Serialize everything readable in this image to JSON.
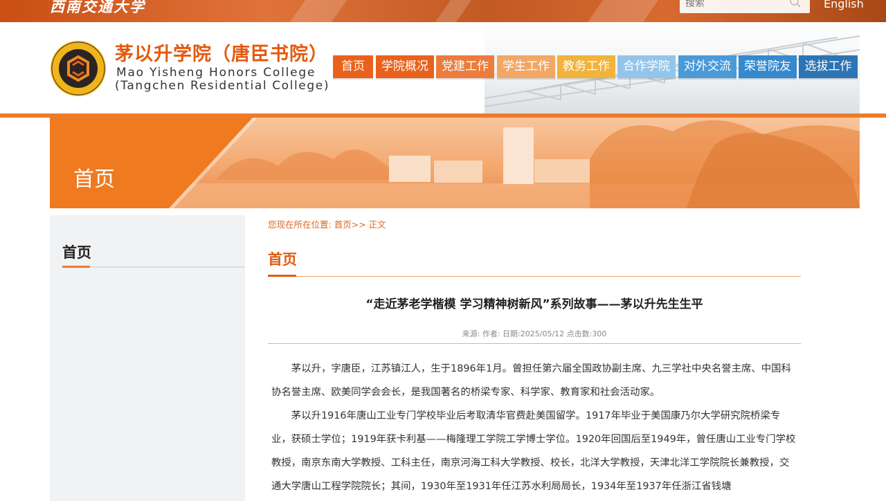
{
  "topbar": {
    "university_name": "西南交通大学",
    "search_placeholder": "搜索",
    "english_link": "English"
  },
  "header": {
    "college_name_cn": "茅以升学院（唐臣书院）",
    "college_name_en_line1": "Mao Yisheng Honors College",
    "college_name_en_line2": "(Tangchen Residential College)",
    "logo_ring_text": "MAO YISHENG HONORS COLLEGE",
    "logo_bottom_text": "西南交通大学茅以升学院"
  },
  "nav": {
    "items": [
      {
        "label": "首页",
        "color": "#e8621d"
      },
      {
        "label": "学院概况",
        "color": "#e8621d"
      },
      {
        "label": "党建工作",
        "color": "#ec7c3c"
      },
      {
        "label": "学生工作",
        "color": "#f2a765"
      },
      {
        "label": "教务工作",
        "color": "#f1b33c"
      },
      {
        "label": "合作学院",
        "color": "#93c5ea"
      },
      {
        "label": "对外交流",
        "color": "#4a9ad8"
      },
      {
        "label": "荣誉院友",
        "color": "#3489cf"
      },
      {
        "label": "选拔工作",
        "color": "#2d74b5"
      }
    ]
  },
  "banner": {
    "title": "首页"
  },
  "sidebar": {
    "title": "首页"
  },
  "breadcrumb": {
    "prefix": "您现在所在位置:",
    "home": "首页",
    "separator": ">>",
    "current": "正文"
  },
  "section": {
    "title": "首页"
  },
  "article": {
    "title": "“走近茅老学楷模 学习精神树新风”系列故事——茅以升先生生平",
    "meta": "来源: 作者: 日期:2025/05/12 点击数:300",
    "paragraphs": [
      "茅以升，字唐臣，江苏镇江人，生于1896年1月。曾担任第六届全国政协副主席、九三学社中央名誉主席、中国科协名誉主席、欧美同学会会长，是我国著名的桥梁专家、科学家、教育家和社会活动家。",
      "茅以升1916年唐山工业专门学校毕业后考取清华官费赴美国留学。1917年毕业于美国康乃尔大学研究院桥梁专业，获硕士学位；1919年获卡利基——梅隆理工学院工学博士学位。1920年回国后至1949年，曾任唐山工业专门学校教授，南京东南大学教授、工科主任，南京河海工科大学教授、校长，北洋大学教授，天津北洋工学院院长兼教授，交通大学唐山工程学院院长；其间，1930年至1931年任江苏水利局局长，1934年至1937年任浙江省钱塘"
    ]
  },
  "colors": {
    "accent": "#e4590d",
    "header_line": "#ee7a2a"
  }
}
